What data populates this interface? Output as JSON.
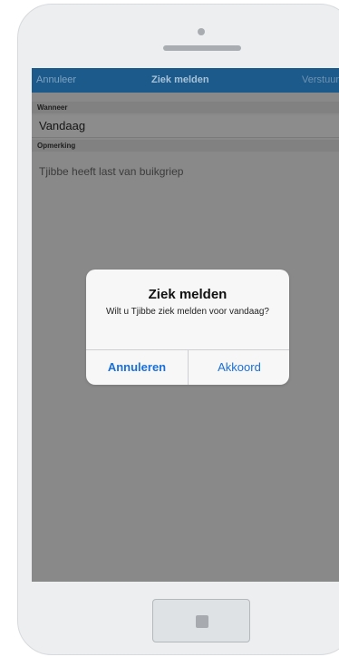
{
  "navbar": {
    "cancel_label": "Annuleer",
    "title": "Ziek melden",
    "send_label": "Verstuur"
  },
  "form": {
    "when_label": "Wanneer",
    "when_value": "Vandaag",
    "remark_label": "Opmerking",
    "remark_value": "Tjibbe heeft last van buikgriep"
  },
  "dialog": {
    "title": "Ziek melden",
    "message": "Wilt u Tjibbe ziek melden voor vandaag?",
    "cancel_button": "Annuleren",
    "ok_button": "Akkoord"
  },
  "colors": {
    "navbar": "#1b5a8a",
    "dialog_button_text": "#1a6fd8",
    "overlay": "#898989"
  }
}
